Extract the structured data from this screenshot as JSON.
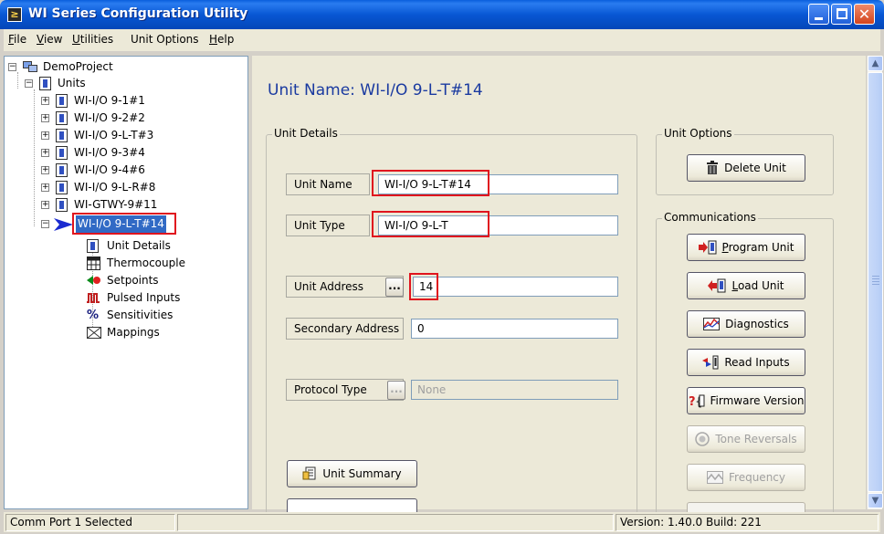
{
  "window": {
    "title": "WI Series Configuration Utility"
  },
  "menu": [
    {
      "label": "File",
      "u": "F",
      "rest": "ile"
    },
    {
      "label": "View",
      "u": "V",
      "rest": "iew"
    },
    {
      "label": "Utilities",
      "u": "U",
      "rest": "tilities"
    },
    {
      "label": "Unit Options",
      "u": "",
      "rest": "Unit Options"
    },
    {
      "label": "Help",
      "u": "H",
      "rest": "elp"
    }
  ],
  "tree": {
    "project": "DemoProject",
    "units_label": "Units",
    "units": [
      {
        "label": "WI-I/O 9-1#1",
        "expander": "+"
      },
      {
        "label": "WI-I/O 9-2#2",
        "expander": "+"
      },
      {
        "label": "WI-I/O 9-L-T#3",
        "expander": "+"
      },
      {
        "label": "WI-I/O 9-3#4",
        "expander": "+"
      },
      {
        "label": "WI-I/O 9-4#6",
        "expander": "+"
      },
      {
        "label": "WI-I/O 9-L-R#8",
        "expander": "+"
      },
      {
        "label": "WI-GTWY-9#11",
        "expander": "+"
      },
      {
        "label": "WI-I/O 9-L-T#14",
        "expander": "−",
        "selected": true
      }
    ],
    "children": [
      {
        "label": "Unit Details",
        "icon": "unit-details-icon"
      },
      {
        "label": "Thermocouple",
        "icon": "thermocouple-icon"
      },
      {
        "label": "Setpoints",
        "icon": "setpoints-icon"
      },
      {
        "label": "Pulsed Inputs",
        "icon": "pulsed-inputs-icon"
      },
      {
        "label": "Sensitivities",
        "icon": "sensitivities-icon"
      },
      {
        "label": "Mappings",
        "icon": "mappings-icon"
      }
    ]
  },
  "main": {
    "header": "Unit Name: WI-I/O 9-L-T#14",
    "unit_details": {
      "legend": "Unit Details",
      "unit_name_label": "Unit Name",
      "unit_name_value": "WI-I/O 9-L-T#14",
      "unit_type_label": "Unit Type",
      "unit_type_value": "WI-I/O 9-L-T",
      "unit_address_label": "Unit Address",
      "unit_address_value": "14",
      "secondary_address_label": "Secondary Address",
      "secondary_address_value": "0",
      "protocol_type_label": "Protocol Type",
      "protocol_type_value": "None",
      "dots_label": "...",
      "unit_summary_label": "Unit Summary"
    },
    "unit_options": {
      "legend": "Unit Options",
      "delete_unit_label": "Delete Unit"
    },
    "communications": {
      "legend": "Communications",
      "buttons": [
        {
          "label": "Program Unit",
          "enabled": true,
          "name": "program-unit-button",
          "icon": "program-unit-icon"
        },
        {
          "label": "Load Unit",
          "enabled": true,
          "name": "load-unit-button",
          "icon": "load-unit-icon"
        },
        {
          "label": "Diagnostics",
          "enabled": true,
          "name": "diagnostics-button",
          "icon": "diagnostics-icon"
        },
        {
          "label": "Read Inputs",
          "enabled": true,
          "name": "read-inputs-button",
          "icon": "read-inputs-icon"
        },
        {
          "label": "Firmware Version",
          "enabled": true,
          "name": "firmware-version-button",
          "icon": "firmware-version-icon"
        },
        {
          "label": "Tone Reversals",
          "enabled": false,
          "name": "tone-reversals-button",
          "icon": "tone-reversals-icon"
        },
        {
          "label": "Frequency",
          "enabled": false,
          "name": "frequency-button",
          "icon": "frequency-icon"
        }
      ]
    }
  },
  "status": {
    "left": "Comm Port 1 Selected",
    "right": "Version: 1.40.0 Build: 221"
  },
  "colors": {
    "title_bar": "#0857d4",
    "header_text": "#1a3aa0",
    "highlight_box": "#e0141e",
    "selection": "#316ac5"
  }
}
